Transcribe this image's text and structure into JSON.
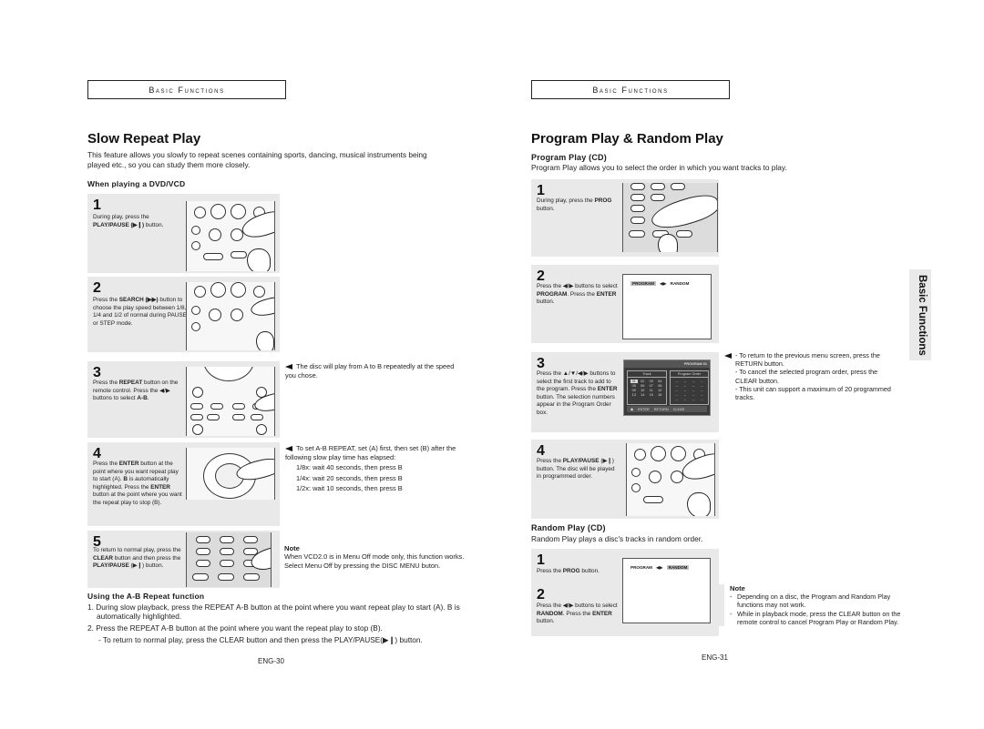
{
  "left_page": {
    "header": "Basic Functions",
    "title": "Slow Repeat Play",
    "intro": "This feature allows you slowly to repeat scenes containing sports, dancing, musical instruments being played etc., so you can study them more closely.",
    "subheading": "When playing a DVD/VCD",
    "steps": [
      {
        "num": "1",
        "text_html": "During play, press the <b>PLAY/PAUSE (▶❙)</b> button.",
        "remote": "play-pause"
      },
      {
        "num": "2",
        "text_html": "Press the <b>SEARCH (▶▶)</b> button to choose the play speed between 1/8, 1/4 and 1/2 of normal during PAUSE or STEP mode.",
        "remote": "search"
      },
      {
        "num": "3",
        "text_html": "Press the <b>REPEAT</b> button on the remote control. Press the ◀/▶ buttons to select <b>A-B</b>.",
        "remote": "repeat"
      },
      {
        "num": "4",
        "text_html": "Press the <b>ENTER</b> button at the point where you want repeat play to start (A). <b>B</b> is automatically highlighted. Press the <b>ENTER</b> button at the point where you want the repeat play to stop (B).",
        "remote": "enter"
      },
      {
        "num": "5",
        "text_html": "To return to normal play, press the <b>CLEAR</b> button and then press the <b>PLAY/PAUSE</b> (▶❙) button.",
        "remote": "clear"
      }
    ],
    "side_notes": {
      "step3": "The disc will play from A to B repeatedly at the speed you chose.",
      "step4_lead": "To set A-B REPEAT, set (A) first, then set (B) after the following slow play time has elapsed:",
      "step4_items": [
        "1/8x: wait 40 seconds, then press B",
        "1/4x: wait 20 seconds, then press B",
        "1/2x: wait 10 seconds, then press B"
      ]
    },
    "note": {
      "title": "Note",
      "text": "When VCD2.0 is in Menu Off mode only, this function works. Select Menu Off by pressing the DISC MENU buton."
    },
    "ab_section": {
      "title": "Using the A-B Repeat function",
      "items": [
        "1. During slow playback, press the REPEAT A-B button at the point where you want repeat play to start (A). B is automatically highlighted.",
        "2. Press the REPEAT A-B button at the point where you want the repeat play to stop (B).",
        "-  To return to normal play, press the CLEAR button and then press the PLAY/PAUSE(▶❙) button."
      ]
    },
    "page_number": "ENG-30"
  },
  "right_page": {
    "header": "Basic Functions",
    "title": "Program Play & Random Play",
    "program": {
      "title": "Program Play (CD)",
      "intro": "Program Play allows you to select the order in which you want tracks to play.",
      "steps": [
        {
          "num": "1",
          "text_html": "During play, press the <b>PROG</b> button."
        },
        {
          "num": "2",
          "text_html": "Press the ◀/▶ buttons to select <b>PROGRAM</b>. Press the <b>ENTER</b> button."
        },
        {
          "num": "3",
          "text_html": "Press the ▲/▼/◀/▶ buttons to select the first track to add to the program. Press the <b>ENTER</b> button. The selection numbers appear in the Program Order box."
        },
        {
          "num": "4",
          "text_html": "Press the <b>PLAY/PAUSE</b> (▶❙) button. The disc will be played in programmed order."
        }
      ],
      "menu_screen": {
        "option_a": "PROGRAM",
        "option_b": "RANDOM",
        "selected": "PROGRAM"
      },
      "osd": {
        "title": "PROGRAM 01",
        "track_label": "Track",
        "order_label": "Program Order",
        "tracks": [
          "01",
          "02",
          "03",
          "04",
          "05",
          "06",
          "07",
          "08",
          "09",
          "10",
          "11",
          "12",
          "13",
          "14",
          "15",
          "16"
        ],
        "order_slots": "--",
        "footer": [
          "◆",
          "ENTER",
          "RETURN",
          "CLEAR"
        ]
      },
      "side_notes": [
        "- To return to the previous menu screen, press the RETURN button.",
        "- To cancel the selected program order, press the CLEAR button.",
        "- This unit can support a maximum of 20 programmed tracks."
      ]
    },
    "random": {
      "title": "Random Play (CD)",
      "intro": "Random Play plays a disc's tracks in random order.",
      "steps": [
        {
          "num": "1",
          "text_html": "Press the <b>PROG</b> button."
        },
        {
          "num": "2",
          "text_html": "Press the ◀/▶ buttons to select <b>RANDOM</b>. Press the <b>ENTER</b> button."
        }
      ],
      "menu_screen": {
        "option_a": "PROGRAM",
        "option_b": "RANDOM",
        "selected": "RANDOM"
      }
    },
    "note": {
      "title": "Note",
      "items": [
        "Depending on a disc, the Program and Random Play functions may not work.",
        "While in playback mode, press the CLEAR button on the remote control to cancel Program Play or Random Play."
      ]
    },
    "side_tab": "Basic Functions",
    "page_number": "ENG-31"
  }
}
